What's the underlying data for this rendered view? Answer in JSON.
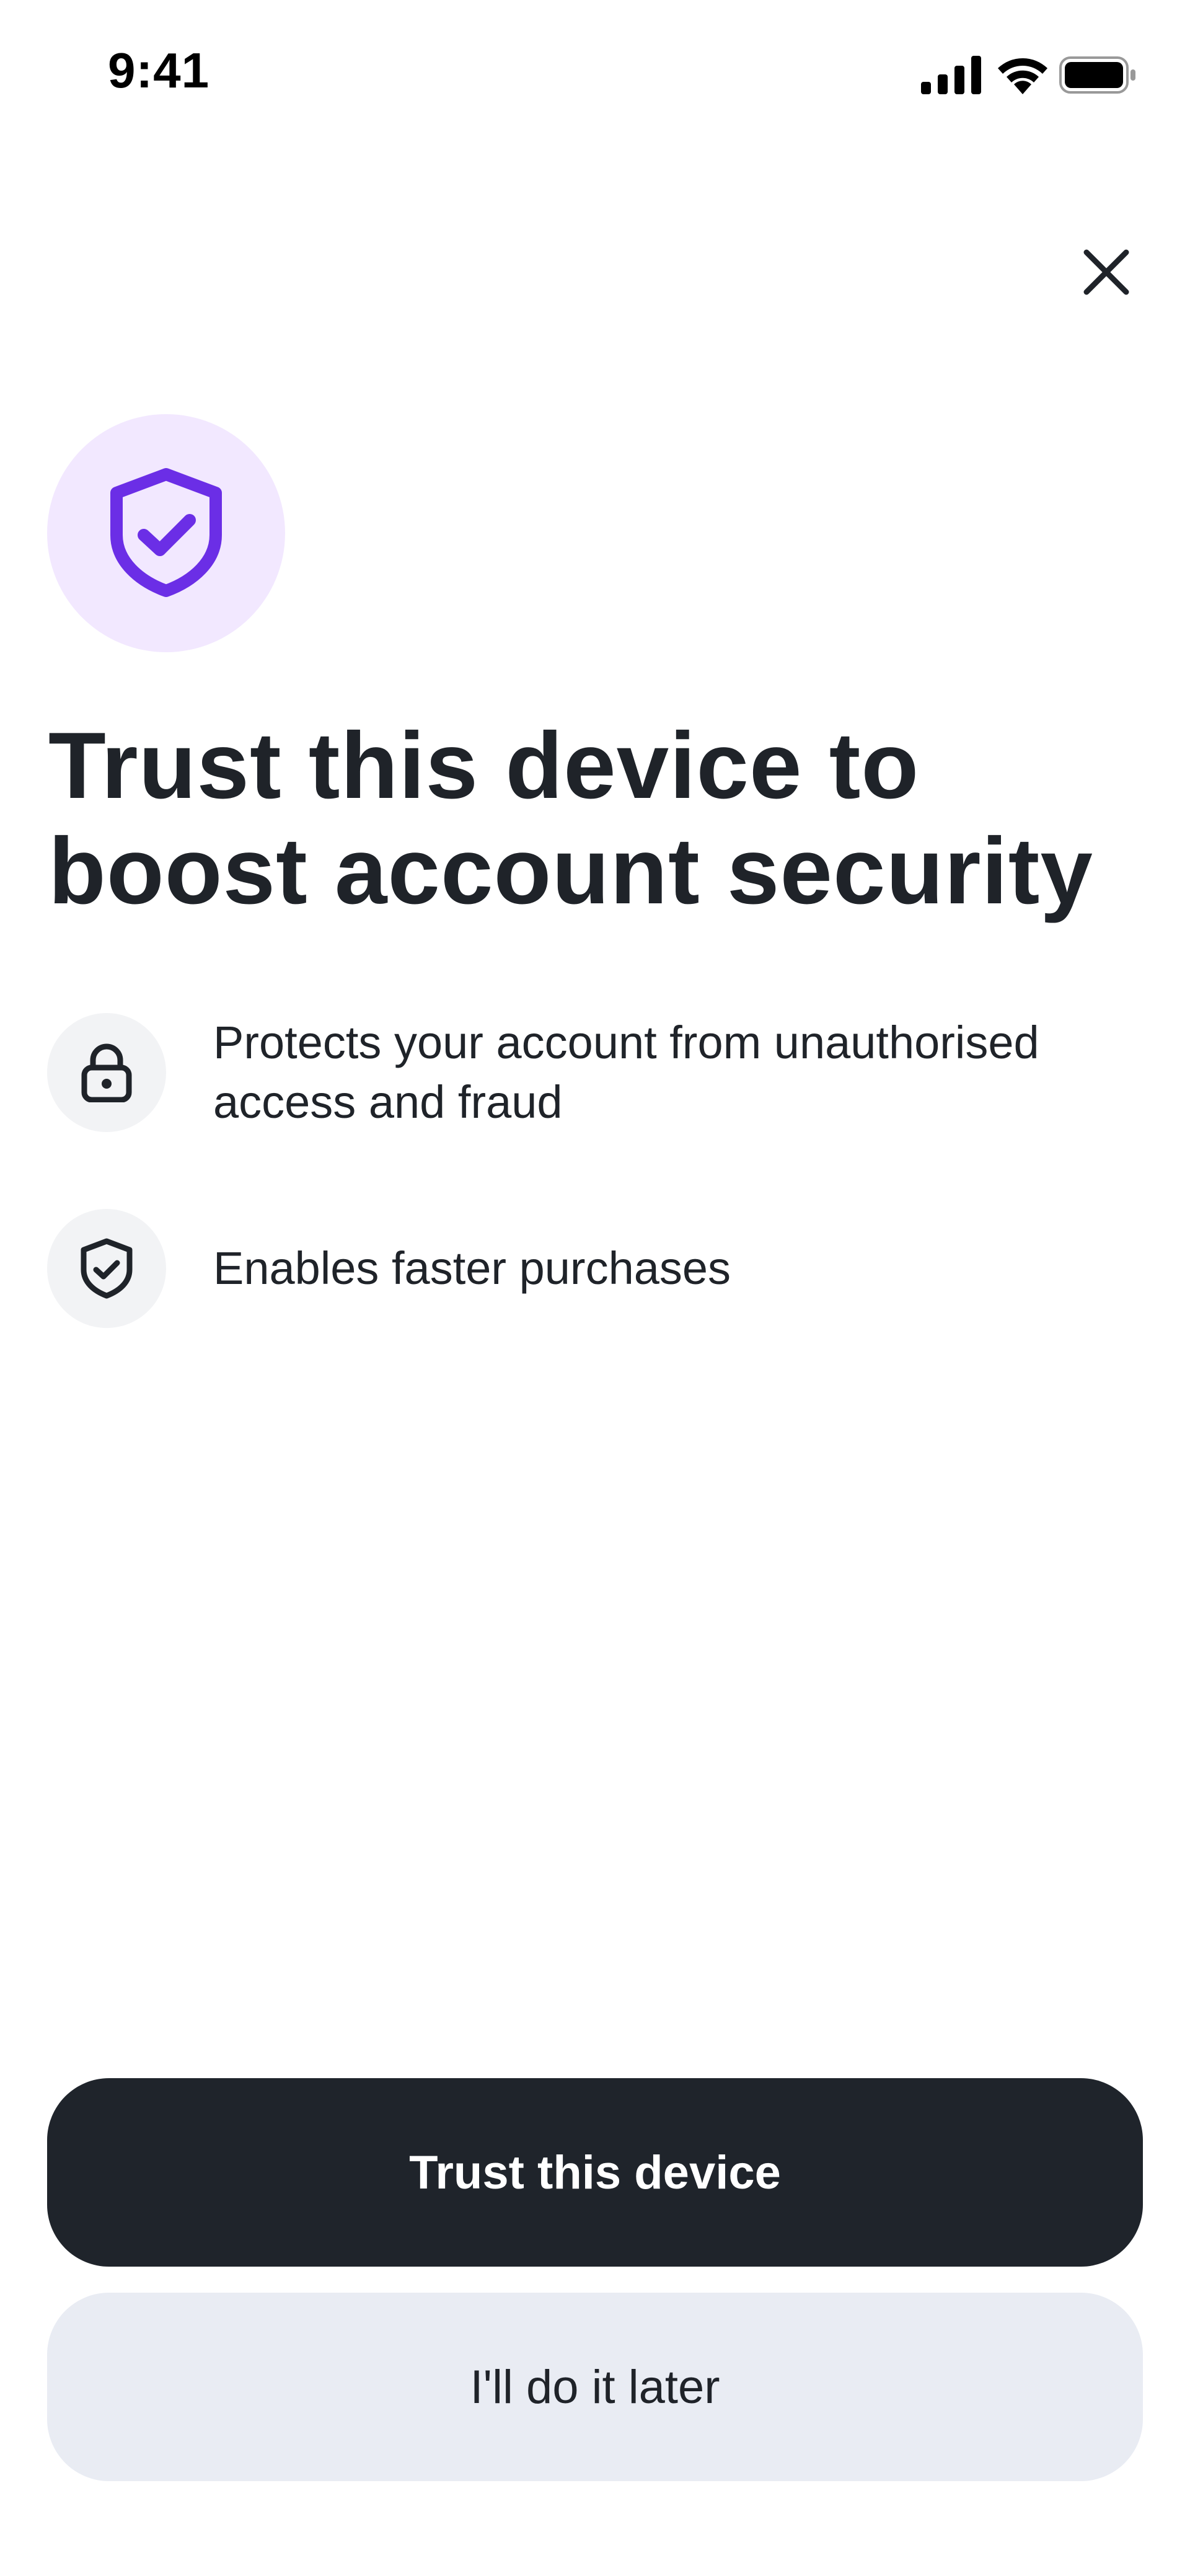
{
  "status_bar": {
    "time": "9:41",
    "icons": [
      "signal-icon",
      "wifi-icon",
      "battery-icon"
    ]
  },
  "header": {
    "close_icon": "close-icon"
  },
  "hero": {
    "icon": "shield-check-icon",
    "badge_color": "#f2e8ff",
    "icon_color": "#6b2ee6"
  },
  "title": {
    "line1": "Trust this device to",
    "line2": "boost account security"
  },
  "features": [
    {
      "icon": "lock-icon",
      "line1": "Protects your account from unauthorised",
      "line2": "access and fraud"
    },
    {
      "icon": "shield-check-icon",
      "line1": "Enables faster purchases"
    }
  ],
  "actions": {
    "primary_label": "Trust this device",
    "secondary_label": "I'll do it later"
  },
  "colors": {
    "primary_button": "#1f242b",
    "secondary_button": "#e9ecf3",
    "text": "#1f2329"
  }
}
